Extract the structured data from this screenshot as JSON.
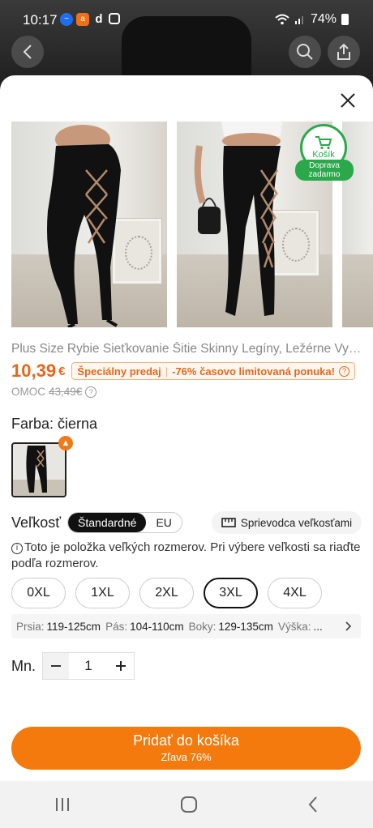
{
  "status_bar": {
    "time": "10:17",
    "battery": "74%",
    "apps": [
      "messenger",
      "alza",
      "d",
      "gallery"
    ]
  },
  "header": {
    "back_icon": "chevron-left-icon",
    "search_icon": "search-icon",
    "share_icon": "share-icon"
  },
  "sheet": {
    "close_icon": "close-icon",
    "cart_badge": {
      "label": "Košík",
      "shipping": "Doprava zadarmo"
    },
    "product": {
      "title": "Plus Size Rybie Sieťkovanie Šitie Skinny Legíny, Ležérne Vyst...",
      "price": "10,39",
      "currency": "€",
      "promo_label": "Špeciálny predaj",
      "promo_offer": "-76% časovo limitovaná ponuka!",
      "omoc_label": "OMOC",
      "omoc_price": "43,49€"
    },
    "color": {
      "label": "Farba: čierna"
    },
    "size": {
      "label": "Veľkosť",
      "standard": "Štandardné",
      "eu": "EU",
      "guide": "Sprievodca veľkosťami",
      "info": "Toto je položka veľkých rozmerov. Pri výbere veľkosti sa riaďte podľa rozmerov.",
      "options": [
        "0XL",
        "1XL",
        "2XL",
        "3XL",
        "4XL"
      ],
      "selected": "3XL",
      "measurements": [
        {
          "k": "Prsia:",
          "v": "119-125cm"
        },
        {
          "k": "Pás:",
          "v": "104-110cm"
        },
        {
          "k": "Boky:",
          "v": "129-135cm"
        },
        {
          "k": "Výška:",
          "v": "..."
        }
      ]
    },
    "quantity": {
      "label": "Mn.",
      "value": "1"
    },
    "add_button": {
      "label": "Pridať do košíka",
      "sub": "Zľava 76%"
    },
    "accent_color": "#f47a0e"
  }
}
